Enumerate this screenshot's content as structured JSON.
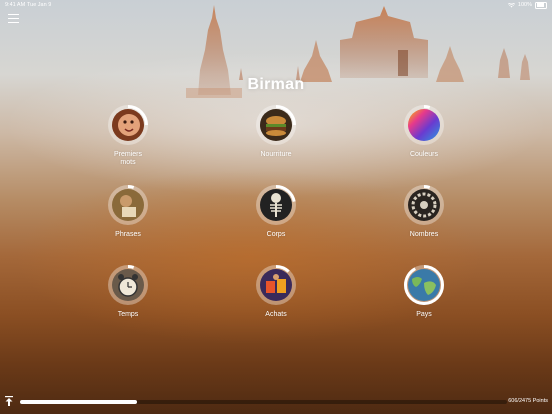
{
  "status_bar": {
    "time": "9:41 AM",
    "date": "Tue Jan 9",
    "battery": "100%"
  },
  "header": {
    "title": "Birman"
  },
  "categories": [
    {
      "label": "Premiers\nmots",
      "icon": "baby-face-photo",
      "progress": 0.25
    },
    {
      "label": "Nourriture",
      "icon": "burger-photo",
      "progress": 0.25
    },
    {
      "label": "Couleurs",
      "icon": "rainbow-paint-photo",
      "progress": 0.05
    },
    {
      "label": "Phrases",
      "icon": "person-reading-photo",
      "progress": 0.05
    },
    {
      "label": "Corps",
      "icon": "skeleton-photo",
      "progress": 0.22
    },
    {
      "label": "Nombres",
      "icon": "number-dial-photo",
      "progress": 0.05
    },
    {
      "label": "Temps",
      "icon": "alarm-clock-photo",
      "progress": 0.05
    },
    {
      "label": "Achats",
      "icon": "shopping-photo",
      "progress": 0.12
    },
    {
      "label": "Pays",
      "icon": "world-map-photo",
      "progress": 0.92
    }
  ],
  "footer": {
    "progress": 0.24,
    "points_label": "606/2475 Points"
  },
  "colors": {
    "accent": "#ffffff",
    "ring_track": "#ffffff59"
  }
}
